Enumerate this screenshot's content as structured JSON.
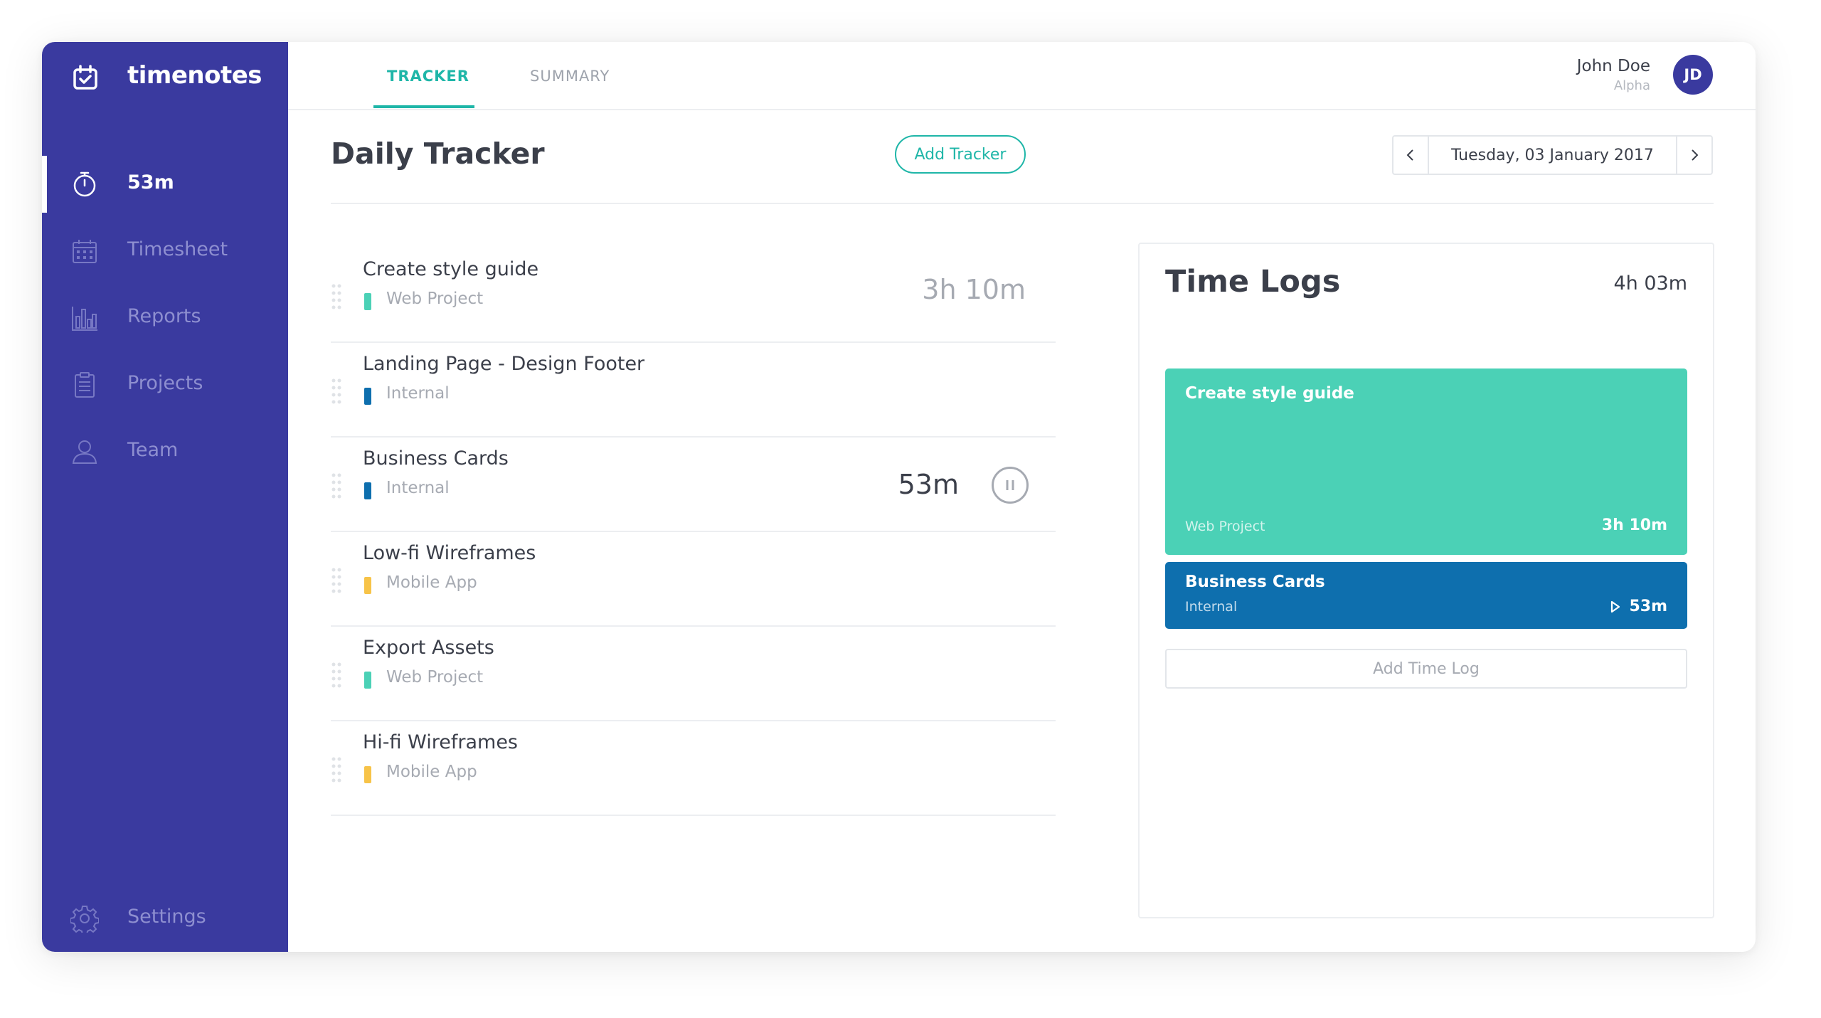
{
  "app": {
    "name": "timenotes"
  },
  "sidebar": {
    "items": [
      {
        "label": "53m",
        "icon": "stopwatch-icon",
        "active": true
      },
      {
        "label": "Timesheet",
        "icon": "calendar-grid-icon"
      },
      {
        "label": "Reports",
        "icon": "bar-chart-icon"
      },
      {
        "label": "Projects",
        "icon": "clipboard-icon"
      },
      {
        "label": "Team",
        "icon": "user-icon"
      }
    ],
    "settings": {
      "label": "Settings",
      "icon": "gear-icon"
    }
  },
  "header": {
    "tabs": [
      {
        "label": "TRACKER",
        "active": true
      },
      {
        "label": "SUMMARY"
      }
    ],
    "user": {
      "name": "John Doe",
      "role": "Alpha",
      "initials": "JD"
    }
  },
  "main": {
    "title": "Daily Tracker",
    "add_tracker_label": "Add Tracker",
    "date": "Tuesday, 03 January 2017",
    "tasks": [
      {
        "title": "Create style guide",
        "project": "Web Project",
        "time": "3h 10m"
      },
      {
        "title": "Landing Page - Design Footer",
        "project": "Internal",
        "time": ""
      },
      {
        "title": "Business Cards",
        "project": "Internal",
        "time": "53m",
        "running": true
      },
      {
        "title": "Low-fi Wireframes",
        "project": "Mobile App",
        "time": ""
      },
      {
        "title": "Export Assets",
        "project": "Web Project",
        "time": ""
      },
      {
        "title": "Hi-fi Wireframes",
        "project": "Mobile App",
        "time": ""
      }
    ]
  },
  "time_logs": {
    "title": "Time Logs",
    "total": "4h 03m",
    "entries": [
      {
        "title": "Create style guide",
        "project": "Web Project",
        "duration": "3h 10m"
      },
      {
        "title": "Business Cards",
        "project": "Internal",
        "duration": "53m"
      }
    ],
    "add_label": "Add Time Log"
  },
  "colors": {
    "sidebar": "#3a3a9f",
    "accent": "#1fb6a8",
    "web_project": "#4bd1b6",
    "internal": "#0e6fae",
    "mobile_app": "#f7c348"
  }
}
